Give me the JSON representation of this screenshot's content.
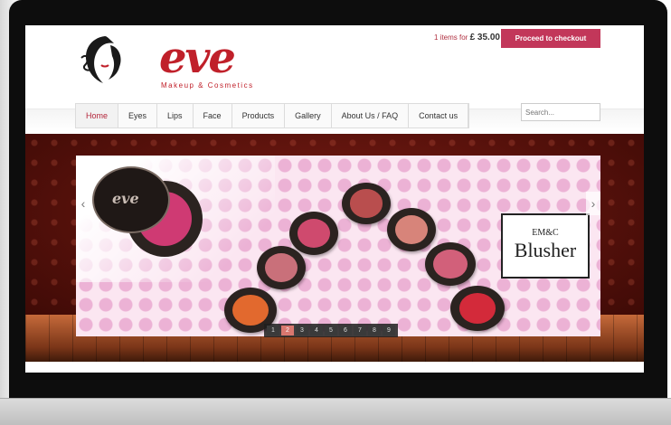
{
  "brand": {
    "name": "eve",
    "tagline": "Makeup & Cosmetics"
  },
  "cart": {
    "items_label": "1 items for",
    "amount": "£ 35.00",
    "checkout_label": "Proceed to checkout"
  },
  "nav": {
    "items": [
      {
        "label": "Home",
        "active": true
      },
      {
        "label": "Eyes"
      },
      {
        "label": "Lips"
      },
      {
        "label": "Face"
      },
      {
        "label": "Products"
      },
      {
        "label": "Gallery"
      },
      {
        "label": "About Us / FAQ"
      },
      {
        "label": "Contact us"
      }
    ]
  },
  "search": {
    "placeholder": "Search..."
  },
  "slider": {
    "compact_brand": "eve",
    "label_top": "EM&C",
    "label_main": "Blusher",
    "prev_icon": "chevron-left-icon",
    "next_icon": "chevron-right-icon",
    "pages": [
      "1",
      "2",
      "3",
      "4",
      "5",
      "6",
      "7",
      "8",
      "9"
    ],
    "active_page": "2"
  },
  "colors": {
    "accent": "#c2375a",
    "brand_red": "#c0202a"
  }
}
